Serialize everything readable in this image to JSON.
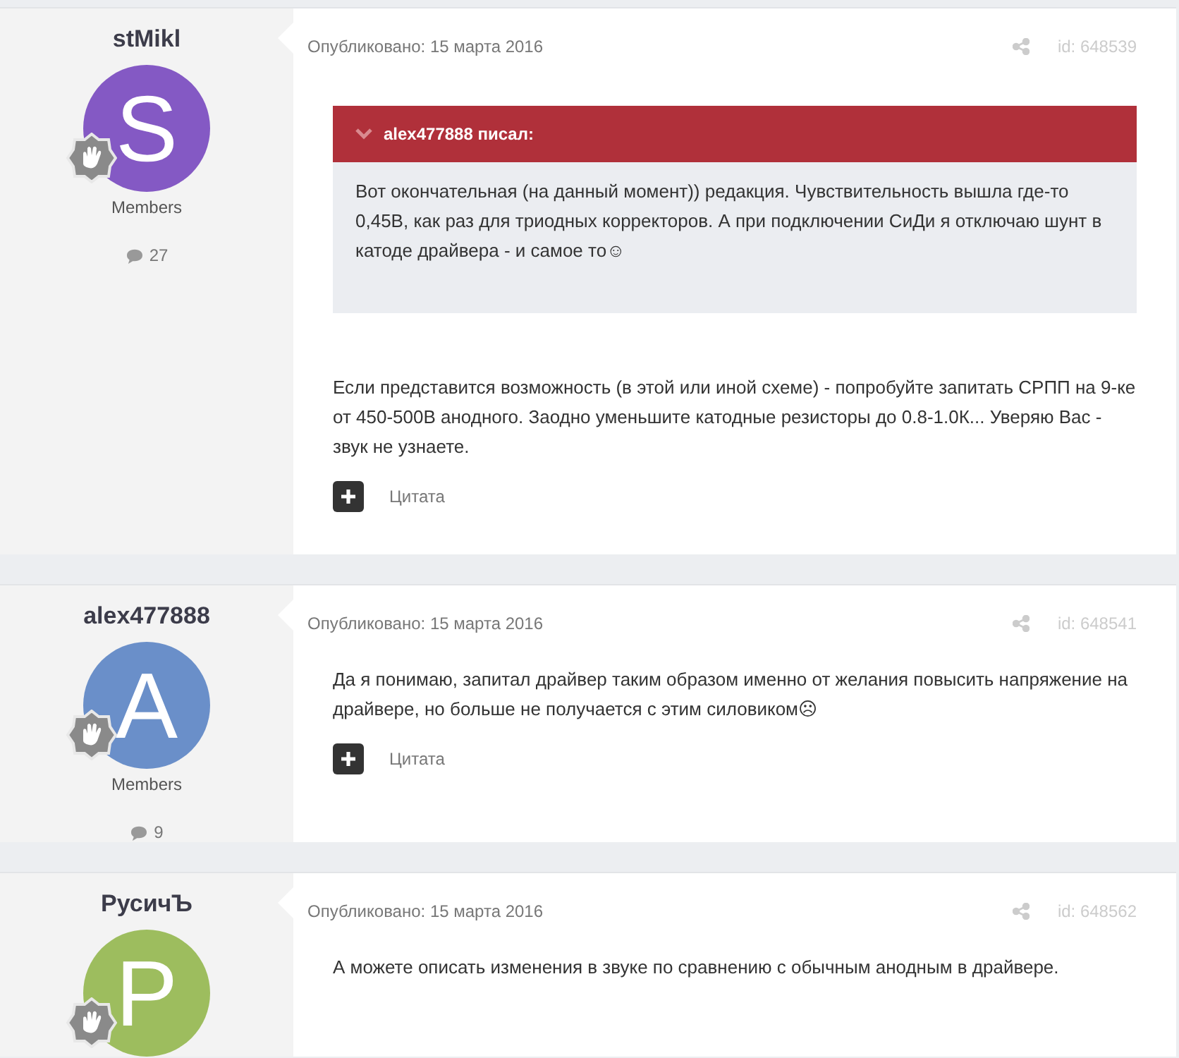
{
  "posts": [
    {
      "author": "stMikl",
      "avatar_letter": "S",
      "color": "#8459c4",
      "rank": "Members",
      "post_count": "27",
      "published": "Опубликовано: 15 марта 2016",
      "post_id": "id: 648539",
      "quote": {
        "header": "alex477888 писал:",
        "text": "Вот окончательная (на данный момент)) редакция. Чувствительность вышла где-то 0,45В, как раз для триодных корректоров. А при подключении СиДи я отключаю шунт в катоде драйвера - и самое то☺"
      },
      "body": "Если представится возможность (в этой или иной схеме) - попробуйте запитать СРПП на 9-ке от 450-500В анодного. Заодно уменьшите катодные резисторы до 0.8-1.0К... Уверяю Вас - звук не узнаете.",
      "quote_button": "Цитата"
    },
    {
      "author": "alex477888",
      "avatar_letter": "A",
      "color": "#6a8fc9",
      "rank": "Members",
      "post_count": "9",
      "published": "Опубликовано: 15 марта 2016",
      "post_id": "id: 648541",
      "body": "Да я понимаю, запитал драйвер таким образом именно от желания повысить напряжение на драйвере, но больше не получается с этим силовиком☹",
      "quote_button": "Цитата"
    },
    {
      "author": "РусичЪ",
      "avatar_letter": "P",
      "color": "#9dbd5e",
      "published": "Опубликовано: 15 марта 2016",
      "post_id": "id: 648562",
      "body": "А можете описать изменения в звуке по сравнению с обычным анодным в драйвере."
    }
  ]
}
